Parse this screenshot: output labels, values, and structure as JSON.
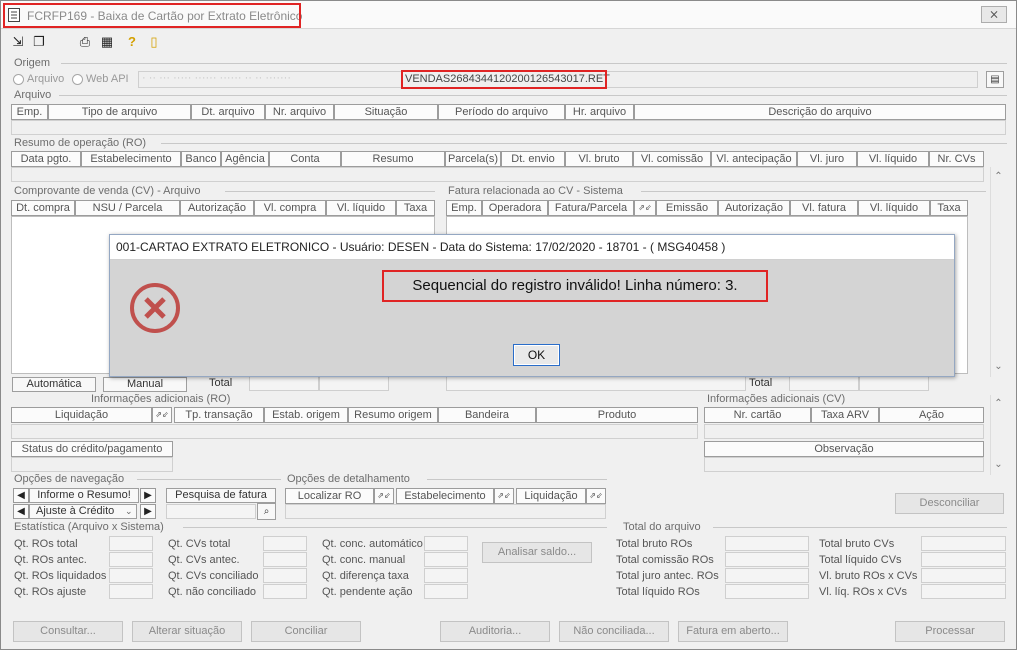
{
  "window": {
    "title": "FCRFP169 - Baixa de Cartão por Extrato Eletrônico",
    "close": "⨯"
  },
  "toolbar": {
    "icons": [
      "arrow-in-icon",
      "copy-icon",
      "print-icon",
      "calculator-icon",
      "help-icon",
      "exit-door-icon"
    ]
  },
  "origem": {
    "label": "Origem",
    "radio_arquivo": "Arquivo",
    "radio_web": "Web API",
    "path_blur": "·  ·· ···  ·····   ······ ······ ·· ··  ·······",
    "file": "VENDAS2684344120200126543017.RET"
  },
  "arquivo": {
    "label": "Arquivo",
    "cols": [
      "Emp.",
      "Tipo de arquivo",
      "Dt. arquivo",
      "Nr. arquivo",
      "Situação",
      "Período do arquivo",
      "Hr. arquivo",
      "Descrição do arquivo"
    ]
  },
  "ro": {
    "label": "Resumo de operação (RO)",
    "cols": [
      "Data pgto.",
      "Estabelecimento",
      "Banco",
      "Agência",
      "Conta",
      "Resumo",
      "Parcela(s)",
      "Dt. envio",
      "Vl. bruto",
      "Vl. comissão",
      "Vl. antecipação",
      "Vl. juro",
      "Vl. líquido",
      "Nr. CVs"
    ]
  },
  "cv": {
    "label": "Comprovante de venda (CV) - Arquivo",
    "cols": [
      "Dt. compra",
      "NSU / Parcela",
      "Autorização",
      "Vl. compra",
      "Vl. líquido",
      "Taxa"
    ]
  },
  "fatura": {
    "label": "Fatura relacionada ao CV - Sistema",
    "cols": [
      "Emp.",
      "Operadora",
      "Fatura/Parcela",
      "Emissão",
      "Autorização",
      "Vl. fatura",
      "Vl. líquido",
      "Taxa"
    ]
  },
  "mode": {
    "automatica": "Automática",
    "manual": "Manual",
    "total": "Total",
    "total2": "Total"
  },
  "info_ro": {
    "label": "Informações adicionais (RO)",
    "cols": [
      "Liquidação",
      "Tp. transação",
      "Estab. origem",
      "Resumo origem",
      "Bandeira",
      "Produto"
    ],
    "status": "Status do crédito/pagamento"
  },
  "info_cv": {
    "label": "Informações adicionais (CV)",
    "cols": [
      "Nr. cartão",
      "Taxa ARV",
      "Ação"
    ],
    "obs": "Observação"
  },
  "nav": {
    "label": "Opções de navegação",
    "informe": "Informe o Resumo!",
    "ajuste": "Ajuste à Crédito",
    "pesquisa": "Pesquisa de fatura"
  },
  "detalhe": {
    "label": "Opções de detalhamento",
    "cols": [
      "Localizar RO",
      "Estabelecimento",
      "Liquidação"
    ]
  },
  "desconciliar": "Desconciliar",
  "estat": {
    "label": "Estatística (Arquivo x Sistema)",
    "c1": [
      "Qt. ROs total",
      "Qt. ROs antec.",
      "Qt. ROs liquidados",
      "Qt. ROs ajuste"
    ],
    "c2": [
      "Qt. CVs total",
      "Qt. CVs antec.",
      "Qt. CVs conciliado",
      "Qt. não conciliado"
    ],
    "c3": [
      "Qt. conc. automático",
      "Qt. conc. manual",
      "Qt. diferença taxa",
      "Qt. pendente ação"
    ],
    "analisar": "Analisar saldo..."
  },
  "total_arq": {
    "label": "Total do arquivo",
    "c1": [
      "Total bruto ROs",
      "Total comissão ROs",
      "Total juro antec. ROs",
      "Total líquido ROs"
    ],
    "c2": [
      "Total bruto CVs",
      "Total líquido CVs",
      "Vl. bruto ROs x CVs",
      "Vl. líq. ROs x CVs"
    ]
  },
  "bottom": {
    "consultar": "Consultar...",
    "alterar": "Alterar situação",
    "conciliar": "Conciliar",
    "auditoria": "Auditoria...",
    "nao_conc": "Não conciliada...",
    "fatura": "Fatura em aberto...",
    "processar": "Processar"
  },
  "dialog": {
    "title": "001-CARTAO EXTRATO ELETRONICO - Usuário: DESEN - Data do Sistema: 17/02/2020 - 18701 - ( MSG40458 )",
    "message": "Sequencial do registro  inválido! Linha número: 3.",
    "ok": "OK",
    "icon": "error-icon"
  },
  "colors": {
    "highlight": "#e02424",
    "error": "#c0504d"
  }
}
